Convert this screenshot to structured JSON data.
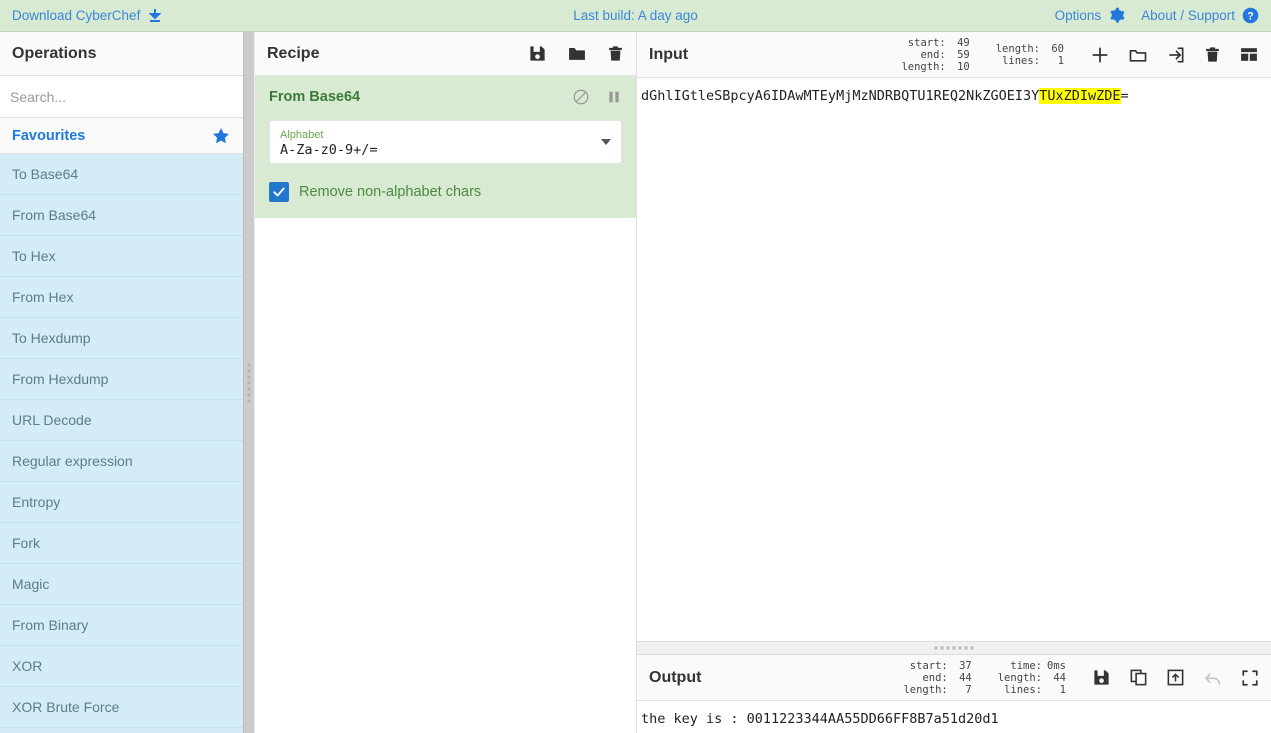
{
  "banner": {
    "download_label": "Download CyberChef",
    "download_icon": "download-icon",
    "last_build": "Last build: A day ago",
    "options_label": "Options",
    "options_icon": "gear-icon",
    "about_label": "About / Support",
    "about_icon": "question-circle-icon",
    "bg_color": "#d9ead3",
    "link_color": "#3a87d8"
  },
  "operations": {
    "title": "Operations",
    "search_placeholder": "Search...",
    "search_value": "",
    "favourites_label": "Favourites",
    "favourites_icon": "star-icon",
    "items": [
      {
        "label": "To Base64"
      },
      {
        "label": "From Base64"
      },
      {
        "label": "To Hex"
      },
      {
        "label": "From Hex"
      },
      {
        "label": "To Hexdump"
      },
      {
        "label": "From Hexdump"
      },
      {
        "label": "URL Decode"
      },
      {
        "label": "Regular expression"
      },
      {
        "label": "Entropy"
      },
      {
        "label": "Fork"
      },
      {
        "label": "Magic"
      },
      {
        "label": "From Binary"
      },
      {
        "label": "XOR"
      },
      {
        "label": "XOR Brute Force"
      }
    ]
  },
  "recipe": {
    "title": "Recipe",
    "icons": [
      {
        "name": "save-icon"
      },
      {
        "name": "folder-icon"
      },
      {
        "name": "trash-icon"
      }
    ],
    "operation": {
      "name": "From Base64",
      "disable_icon": "disable-circle-slash-icon",
      "breakpoint_icon": "pause-icon",
      "alphabet_label": "Alphabet",
      "alphabet_value": "A-Za-z0-9+/=",
      "checkbox_label": "Remove non-alphabet chars",
      "checkbox_checked": true
    }
  },
  "input": {
    "title": "Input",
    "meta_left": [
      {
        "key": "start:",
        "value": "49"
      },
      {
        "key": "end:",
        "value": "59"
      },
      {
        "key": "length:",
        "value": "10"
      }
    ],
    "meta_right": [
      {
        "key": "length:",
        "value": "60"
      },
      {
        "key": "lines:",
        "value": "1"
      }
    ],
    "icons": [
      {
        "name": "add-tab-icon"
      },
      {
        "name": "open-folder-icon"
      },
      {
        "name": "import-icon"
      },
      {
        "name": "clear-trash-icon"
      },
      {
        "name": "tabs-layout-icon"
      }
    ],
    "text_before": "dGhlIGtleSBpcyA6IDAwMTEyMjMzNDRBQTU1REQ2NkZGOEI3Y",
    "text_highlight": "TUxZDIwZDE",
    "text_after": "=",
    "highlight_color": "#ffff00"
  },
  "output": {
    "title": "Output",
    "meta_left": [
      {
        "key": "start:",
        "value": "37"
      },
      {
        "key": "end:",
        "value": "44"
      },
      {
        "key": "length:",
        "value": "7"
      }
    ],
    "meta_right": [
      {
        "key": "time:",
        "value": "0ms"
      },
      {
        "key": "length:",
        "value": "44"
      },
      {
        "key": "lines:",
        "value": "1"
      }
    ],
    "icons": [
      {
        "name": "save-icon"
      },
      {
        "name": "copy-icon"
      },
      {
        "name": "export-icon"
      },
      {
        "name": "undo-icon"
      },
      {
        "name": "maximise-icon"
      }
    ],
    "text": "the key is : 0011223344AA55DD66FF8B7a51d20d1"
  }
}
